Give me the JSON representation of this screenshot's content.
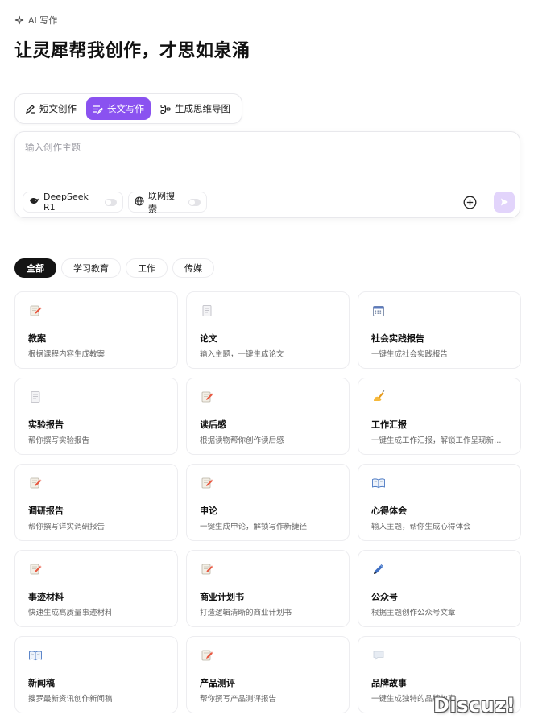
{
  "header": {
    "label": "AI 写作",
    "title": "让灵犀帮我创作，才思如泉涌"
  },
  "mode_tabs": [
    {
      "label": "短文创作",
      "icon": "pen-icon",
      "active": false
    },
    {
      "label": "长文写作",
      "icon": "long-text-icon",
      "active": true
    },
    {
      "label": "生成思维导图",
      "icon": "mindmap-icon",
      "active": false
    }
  ],
  "composer": {
    "placeholder": "输入创作主题",
    "model_chip": "DeepSeek R1",
    "web_chip": "联网搜索"
  },
  "filters": [
    {
      "label": "全部",
      "active": true
    },
    {
      "label": "学习教育",
      "active": false
    },
    {
      "label": "工作",
      "active": false
    },
    {
      "label": "传媒",
      "active": false
    }
  ],
  "cards": [
    {
      "title": "教案",
      "desc": "根据课程内容生成教案",
      "icon": "memo-icon"
    },
    {
      "title": "论文",
      "desc": "输入主题，一键生成论文",
      "icon": "document-icon"
    },
    {
      "title": "社会实践报告",
      "desc": "一键生成社会实践报告",
      "icon": "calendar-icon"
    },
    {
      "title": "实验报告",
      "desc": "帮你撰写实验报告",
      "icon": "document-icon"
    },
    {
      "title": "读后感",
      "desc": "根据读物帮你创作读后感",
      "icon": "memo-icon"
    },
    {
      "title": "工作汇报",
      "desc": "一键生成工作汇报，解锁工作呈现新…",
      "icon": "writing-hand-icon"
    },
    {
      "title": "调研报告",
      "desc": "帮你撰写详实调研报告",
      "icon": "memo-icon"
    },
    {
      "title": "申论",
      "desc": "一键生成申论，解锁写作新捷径",
      "icon": "memo-icon"
    },
    {
      "title": "心得体会",
      "desc": "输入主题，帮你生成心得体会",
      "icon": "open-book-icon"
    },
    {
      "title": "事迹材料",
      "desc": "快速生成高质量事迹材料",
      "icon": "memo-icon"
    },
    {
      "title": "商业计划书",
      "desc": "打造逻辑清晰的商业计划书",
      "icon": "memo-icon"
    },
    {
      "title": "公众号",
      "desc": "根据主题创作公众号文章",
      "icon": "fountain-pen-icon"
    },
    {
      "title": "新闻稿",
      "desc": "搜罗最新资讯创作新闻稿",
      "icon": "open-book-icon"
    },
    {
      "title": "产品测评",
      "desc": "帮你撰写产品测评报告",
      "icon": "memo-icon"
    },
    {
      "title": "品牌故事",
      "desc": "一键生成独特的品牌故事",
      "icon": "speech-bubble-icon"
    }
  ],
  "watermark": "Discuz!"
}
